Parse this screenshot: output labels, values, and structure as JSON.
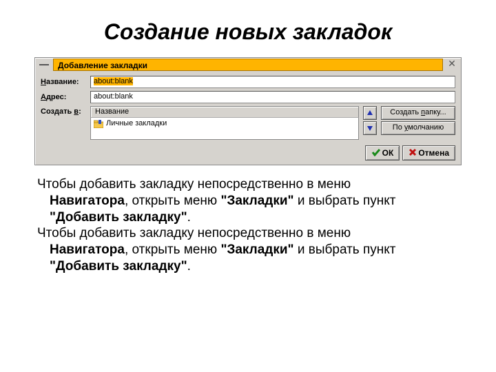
{
  "slide": {
    "title": "Создание новых закладок"
  },
  "dialog": {
    "title": "Добавление закладки",
    "labels": {
      "name": "Название:",
      "address": "Адрес:",
      "createIn": "Создать в:",
      "treeHeader": "Название"
    },
    "fields": {
      "name_value": "about:blank",
      "address_value": "about:blank"
    },
    "tree": {
      "root": "Личные закладки"
    },
    "buttons": {
      "newFolder": "Создать папку...",
      "default": "По умолчанию",
      "ok": "ОК",
      "cancel": "Отмена"
    }
  },
  "description": {
    "p1a": "Чтобы добавить закладку непосредственно в меню",
    "p1b_bold": "Навигатора",
    "p1c": ", открыть меню ",
    "p1d_bold": "\"Закладки\"",
    "p1e": " и выбрать пункт",
    "p1f_bold": "\"Добавить закладку\"",
    "p1g": ".",
    "p2a": "Чтобы добавить закладку непосредственно в меню",
    "p2b_bold": "Навигатора",
    "p2c": ", открыть меню ",
    "p2d_bold": "\"Закладки\"",
    "p2e": " и выбрать пункт",
    "p2f_bold": "\"Добавить закладку\"",
    "p2g": "."
  }
}
